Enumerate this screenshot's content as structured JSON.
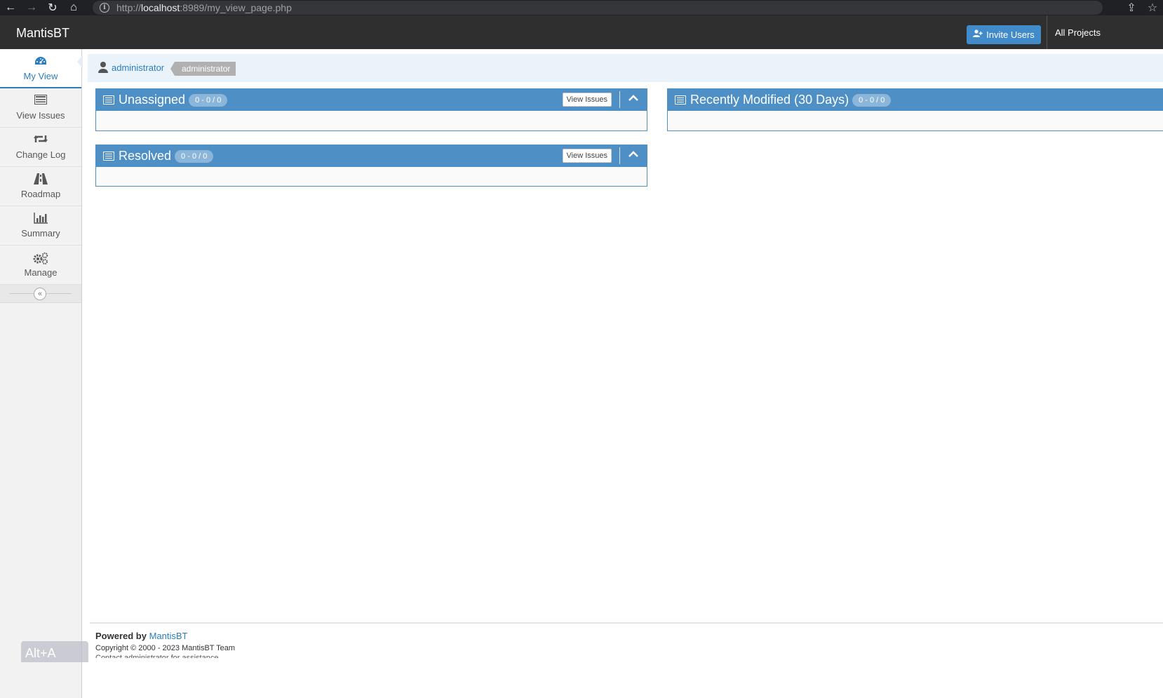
{
  "browser": {
    "url_prefix": "http://",
    "url_host": "localhost",
    "url_rest": ":8989/my_view_page.php"
  },
  "navbar": {
    "brand": "MantisBT",
    "invite_label": "Invite Users",
    "project_label": "All Projects"
  },
  "sidebar": {
    "items": [
      {
        "label": "My View",
        "icon": "dashboard-icon"
      },
      {
        "label": "View Issues",
        "icon": "list-icon"
      },
      {
        "label": "Change Log",
        "icon": "retweet-icon"
      },
      {
        "label": "Roadmap",
        "icon": "road-icon"
      },
      {
        "label": "Summary",
        "icon": "bar-chart-icon"
      },
      {
        "label": "Manage",
        "icon": "gears-icon"
      }
    ],
    "collapse_glyph": "«",
    "alt_hint": "Alt+A"
  },
  "breadcrumb": {
    "user_link": "administrator",
    "role_badge": "administrator"
  },
  "widgets": {
    "unassigned": {
      "title": "Unassigned",
      "count": "0 - 0 / 0",
      "view_label": "View Issues"
    },
    "resolved": {
      "title": "Resolved",
      "count": "0 - 0 / 0",
      "view_label": "View Issues"
    },
    "recent": {
      "title": "Recently Modified (30 Days)",
      "count": "0 - 0 / 0"
    }
  },
  "footer": {
    "powered_by": "Powered by",
    "powered_link": "MantisBT",
    "copyright": "Copyright © 2000 - 2023 MantisBT Team",
    "contact": "Contact administrator for assistance"
  },
  "colors": {
    "accent": "#4e8fc6",
    "link": "#2b7dbc",
    "navbar": "#2f2f2f"
  }
}
